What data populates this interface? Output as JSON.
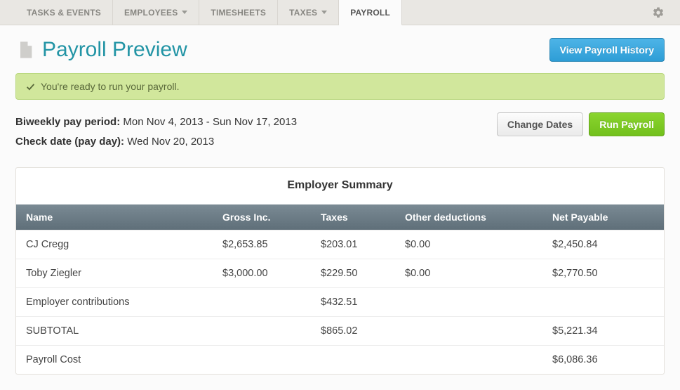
{
  "tabs": [
    {
      "label": "TASKS & EVENTS",
      "dropdown": false,
      "active": false
    },
    {
      "label": "EMPLOYEES",
      "dropdown": true,
      "active": false
    },
    {
      "label": "TIMESHEETS",
      "dropdown": false,
      "active": false
    },
    {
      "label": "TAXES",
      "dropdown": true,
      "active": false
    },
    {
      "label": "PAYROLL",
      "dropdown": false,
      "active": true
    }
  ],
  "page": {
    "title": "Payroll Preview",
    "history_button": "View Payroll History"
  },
  "alert": {
    "message": "You're ready to run your payroll."
  },
  "period": {
    "label1": "Biweekly pay period:",
    "range": "Mon Nov 4, 2013 - Sun Nov 17, 2013",
    "label2": "Check date (pay day):",
    "check_date": "Wed Nov 20, 2013",
    "change_dates": "Change Dates",
    "run_payroll": "Run Payroll"
  },
  "summary": {
    "title": "Employer Summary",
    "headers": {
      "name": "Name",
      "gross": "Gross Inc.",
      "taxes": "Taxes",
      "other": "Other deductions",
      "net": "Net Payable"
    },
    "rows": [
      {
        "name": "CJ Cregg",
        "gross": "$2,653.85",
        "taxes": "$203.01",
        "other": "$0.00",
        "net": "$2,450.84"
      },
      {
        "name": "Toby Ziegler",
        "gross": "$3,000.00",
        "taxes": "$229.50",
        "other": "$0.00",
        "net": "$2,770.50"
      },
      {
        "name": "Employer contributions",
        "gross": "",
        "taxes": "$432.51",
        "other": "",
        "net": ""
      },
      {
        "name": "SUBTOTAL",
        "gross": "",
        "taxes": "$865.02",
        "other": "",
        "net": "$5,221.34"
      },
      {
        "name": "Payroll Cost",
        "gross": "",
        "taxes": "",
        "other": "",
        "net": "$6,086.36"
      }
    ]
  }
}
